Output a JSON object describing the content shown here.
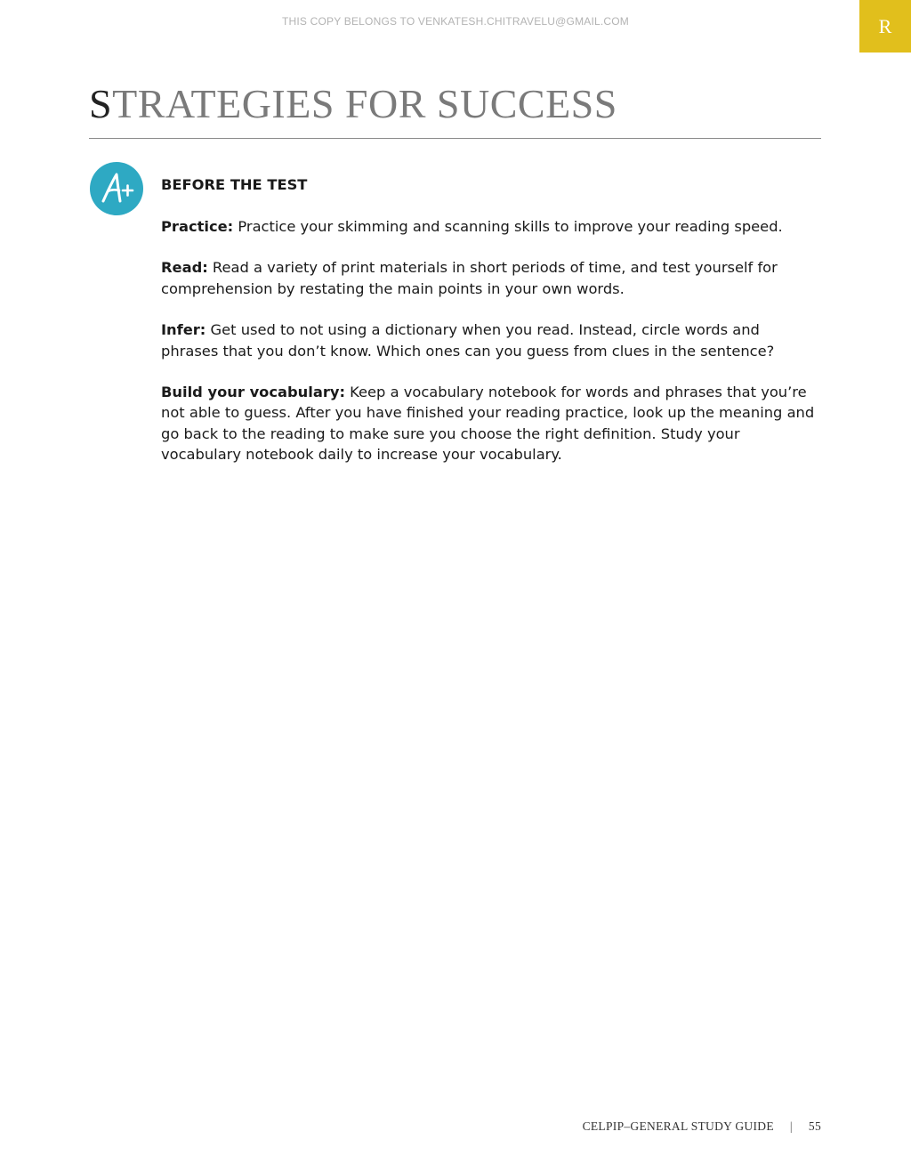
{
  "header": {
    "watermark": "THIS COPY BELONGS TO VENKATESH.CHITRAVELU@GMAIL.COM",
    "section_tab_letter": "R",
    "tab_color": "#e1bf1c"
  },
  "page": {
    "title_first_letter": "S",
    "title_rest": "TRATEGIES FOR SUCCESS"
  },
  "badge": {
    "text": "A+",
    "icon": "a-plus-grade-icon",
    "color": "#2ea9c3"
  },
  "section": {
    "heading": "BEFORE THE TEST",
    "items": [
      {
        "term": "Practice:",
        "text": " Practice your skimming and scanning skills to improve your reading speed."
      },
      {
        "term": "Read:",
        "text": " Read a variety of print materials in short periods of time, and test yourself for comprehension by restating the main points in your own words."
      },
      {
        "term": "Infer:",
        "text": " Get used to not using a dictionary when you read. Instead, circle words and phrases that you don’t know. Which ones can you guess from clues in the sentence?"
      },
      {
        "term": "Build your vocabulary:",
        "text": " Keep a vocabulary notebook for words and phrases that you’re not able to guess. After you have finished your reading practice, look up the meaning and go back to the reading to make sure you choose the right definition. Study your vocabulary notebook daily to increase your vocabulary."
      }
    ]
  },
  "footer": {
    "guide_name": "CELPIP–GENERAL STUDY GUIDE",
    "separator": "|",
    "page_number": "55"
  }
}
